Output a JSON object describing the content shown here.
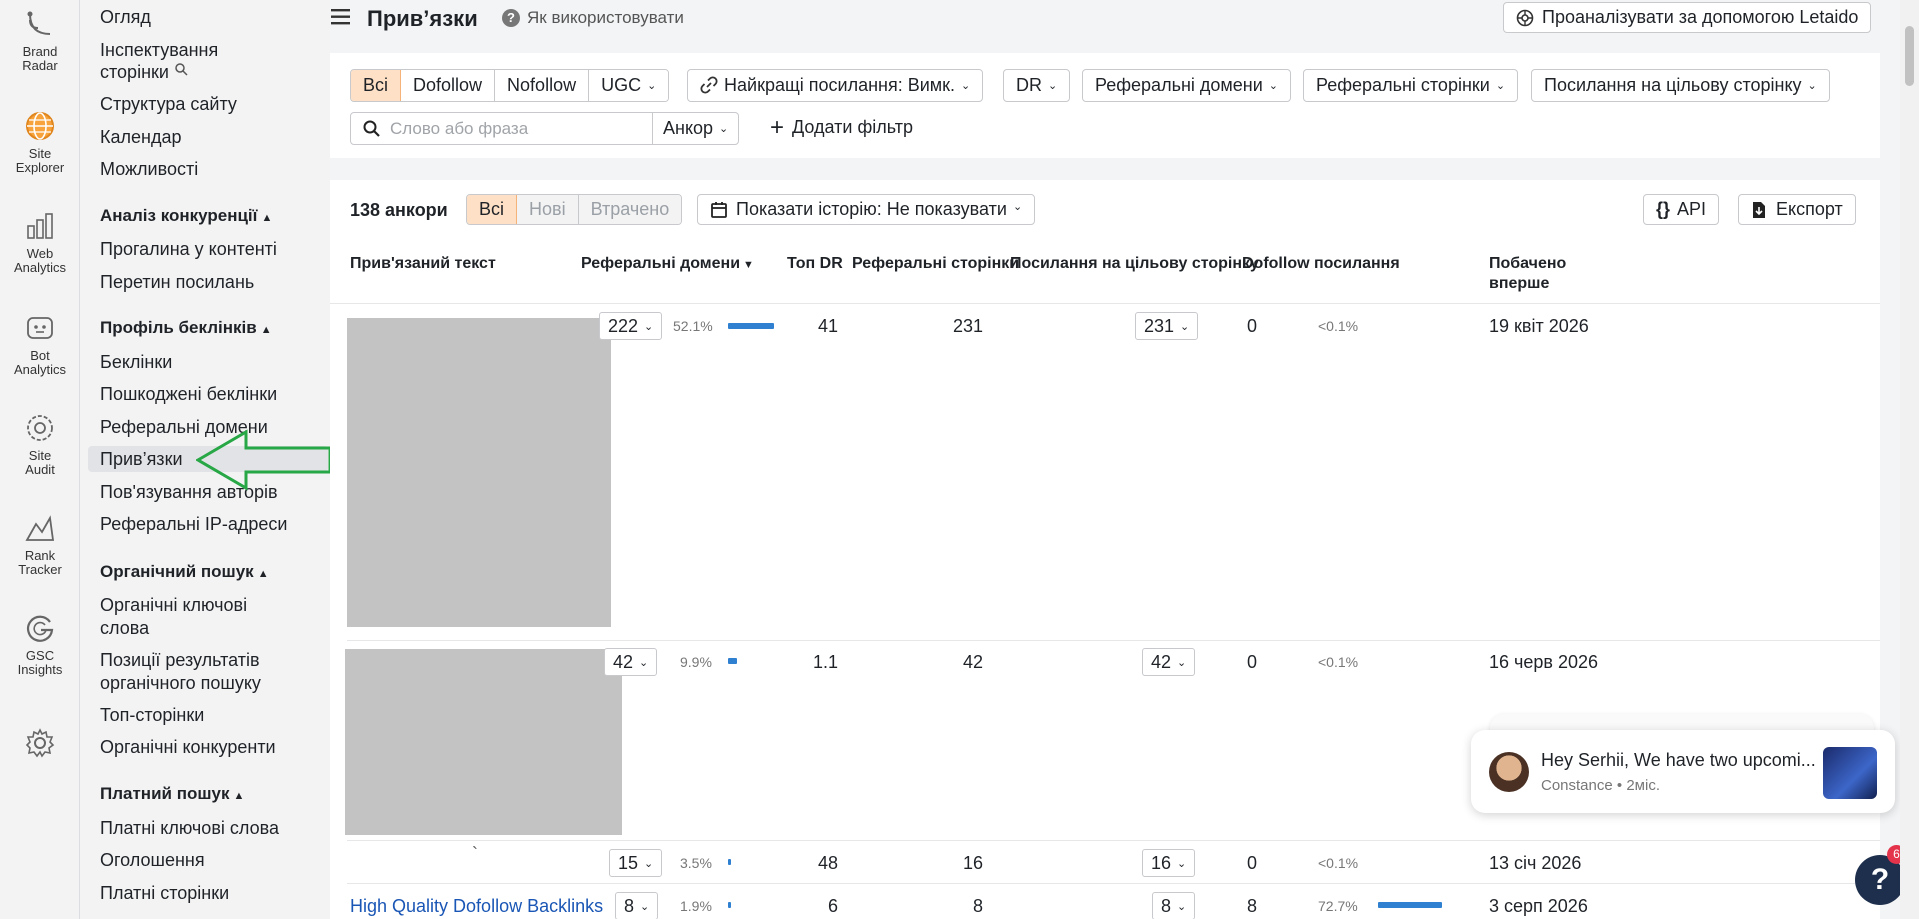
{
  "rail": [
    {
      "label1": "Brand",
      "label2": "Radar",
      "icon": "brand-radar-icon"
    },
    {
      "label1": "Site",
      "label2": "Explorer",
      "icon": "site-explorer-icon"
    },
    {
      "label1": "Web",
      "label2": "Analytics",
      "icon": "web-analytics-icon"
    },
    {
      "label1": "Bot",
      "label2": "Analytics",
      "icon": "bot-analytics-icon"
    },
    {
      "label1": "Site",
      "label2": "Audit",
      "icon": "site-audit-icon"
    },
    {
      "label1": "Rank",
      "label2": "Tracker",
      "icon": "rank-tracker-icon"
    },
    {
      "label1": "GSC",
      "label2": "Insights",
      "icon": "gsc-insights-icon"
    }
  ],
  "nav": {
    "overview": "Огляд",
    "inspect1": "Інспектування",
    "inspect2": "сторінки",
    "structure": "Структура сайту",
    "calendar": "Календар",
    "opportunities": "Можливості",
    "competitive_head": "Аналіз конкуренції",
    "content_gap": "Прогалина у контенті",
    "link_intersect": "Перетин посилань",
    "backlink_head": "Профіль беклінків",
    "backlinks": "Беклінки",
    "broken_backlinks": "Пошкоджені беклінки",
    "ref_domains": "Реферальні домени",
    "anchors": "Прив’язки",
    "author_links": "Пов'язування авторів",
    "ref_ips": "Реферальні IP-адреси",
    "organic_head": "Органічний пошук",
    "organic_kw1": "Органічні ключові",
    "organic_kw2": "слова",
    "serp_pos1": "Позиції результатів",
    "serp_pos2": "органічного пошуку",
    "top_pages": "Топ-сторінки",
    "organic_comp": "Органічні конкуренти",
    "paid_head": "Платний пошук",
    "paid_kw": "Платні ключові слова",
    "ads": "Оголошення",
    "paid_pages": "Платні сторінки"
  },
  "header": {
    "title": "Прив’язки",
    "help": "Як використовувати",
    "letaido": "Проаналізувати за допомогою Letaido"
  },
  "filters": {
    "link_types": [
      "Всі",
      "Dofollow",
      "Nofollow",
      "UGC"
    ],
    "best_links": "Найкращі посилання: Вимк.",
    "dr": "DR",
    "ref_domains": "Реферальні домени",
    "ref_pages": "Реферальні сторінки",
    "target_links": "Посилання на цільову сторінку",
    "search_placeholder": "Слово або фраза",
    "anchor": "Анкор",
    "add_filter": "Додати фільтр"
  },
  "table": {
    "count": "138 анкори",
    "tabs": [
      "Всі",
      "Нові",
      "Втрачено"
    ],
    "history": "Показати історію: Не показувати",
    "api": "API",
    "export": "Експорт",
    "columns": {
      "anchor": "Прив'язаний текст",
      "ref_domains": "Реферальні домени",
      "top_dr": "Топ DR",
      "ref_pages": "Реферальні сторінки",
      "target_links": "Посилання на цільову сторінку",
      "dofollow": "Dofollow посилання",
      "first_seen1": "Побачено",
      "first_seen2": "вперше"
    },
    "rows": [
      {
        "anchor": "",
        "ref_domains": "222",
        "pct": "52.1%",
        "bar": 0.521,
        "top_dr": "41",
        "ref_pages": "231",
        "target": "231",
        "dofollow": "0",
        "dofollow_pct": "<0.1%",
        "first_seen": "19 квіт 2026"
      },
      {
        "anchor": "",
        "ref_domains": "42",
        "pct": "9.9%",
        "bar": 0.099,
        "top_dr": "1.1",
        "ref_pages": "42",
        "target": "42",
        "dofollow": "0",
        "dofollow_pct": "<0.1%",
        "first_seen": "16 черв 2026"
      },
      {
        "anchor": "`",
        "ref_domains": "15",
        "pct": "3.5%",
        "bar": 0.035,
        "top_dr": "48",
        "ref_pages": "16",
        "target": "16",
        "dofollow": "0",
        "dofollow_pct": "<0.1%",
        "first_seen": "13 січ 2026"
      },
      {
        "anchor": "High Quality Dofollow Backlinks",
        "ref_domains": "8",
        "pct": "1.9%",
        "bar": 0.019,
        "top_dr": "6",
        "ref_pages": "8",
        "target": "8",
        "dofollow": "8",
        "dofollow_pct": "72.7%",
        "dofollow_bar": 0.727,
        "first_seen": "3 серп 2026"
      }
    ]
  },
  "chat": {
    "message": "Hey Serhii, We have two upcomi...",
    "sender": "Constance",
    "time": "2міс.",
    "sep": "•",
    "badge": "6",
    "help": "?"
  },
  "colors": {
    "accent": "#fde0c5",
    "bar": "#2f80d1",
    "arrow": "#27a745"
  }
}
